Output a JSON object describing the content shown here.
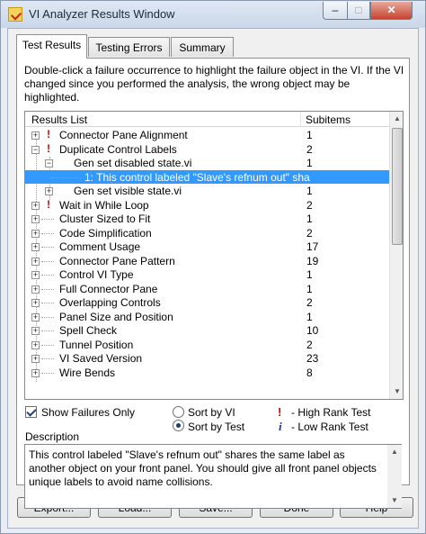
{
  "window": {
    "title": "VI Analyzer Results Window",
    "minimize_glyph": "–",
    "maximize_glyph": "□",
    "close_glyph": "✕"
  },
  "tabs": [
    {
      "label": "Test Results",
      "active": true
    },
    {
      "label": "Testing Errors",
      "active": false
    },
    {
      "label": "Summary",
      "active": false
    }
  ],
  "instructions": "Double-click a failure occurrence to highlight the failure object in the VI.  If the VI changed since you performed the analysis, the wrong object may be highlighted.",
  "results": {
    "header": {
      "results_list": "Results List",
      "subitems": "Subitems"
    },
    "rows": [
      {
        "label": "Connector Pane Alignment",
        "subitems": "1",
        "expander": "+",
        "rank": "!"
      },
      {
        "label": "Duplicate Control Labels",
        "subitems": "2",
        "expander": "−",
        "rank": "!"
      },
      {
        "label": "Gen set disabled state.vi",
        "subitems": "1",
        "expander": "−",
        "rank": ""
      },
      {
        "label": "1: This control labeled \"Slave's refnum out\" sha",
        "subitems": "",
        "expander": "",
        "rank": "",
        "selected": true
      },
      {
        "label": "Gen set visible state.vi",
        "subitems": "1",
        "expander": "+",
        "rank": ""
      },
      {
        "label": "Wait in While Loop",
        "subitems": "2",
        "expander": "+",
        "rank": "!"
      },
      {
        "label": "Cluster Sized to Fit",
        "subitems": "1",
        "expander": "+",
        "rank": ""
      },
      {
        "label": "Code Simplification",
        "subitems": "2",
        "expander": "+",
        "rank": ""
      },
      {
        "label": "Comment Usage",
        "subitems": "17",
        "expander": "+",
        "rank": ""
      },
      {
        "label": "Connector Pane Pattern",
        "subitems": "19",
        "expander": "+",
        "rank": ""
      },
      {
        "label": "Control VI Type",
        "subitems": "1",
        "expander": "+",
        "rank": ""
      },
      {
        "label": "Full Connector Pane",
        "subitems": "1",
        "expander": "+",
        "rank": ""
      },
      {
        "label": "Overlapping Controls",
        "subitems": "2",
        "expander": "+",
        "rank": ""
      },
      {
        "label": "Panel Size and Position",
        "subitems": "1",
        "expander": "+",
        "rank": ""
      },
      {
        "label": "Spell Check",
        "subitems": "10",
        "expander": "+",
        "rank": ""
      },
      {
        "label": "Tunnel Position",
        "subitems": "2",
        "expander": "+",
        "rank": ""
      },
      {
        "label": "VI Saved Version",
        "subitems": "23",
        "expander": "+",
        "rank": ""
      },
      {
        "label": "Wire Bends",
        "subitems": "8",
        "expander": "+",
        "rank": ""
      }
    ],
    "scroll_up": "▲",
    "scroll_down": "▼"
  },
  "options": {
    "show_failures_only": {
      "label": "Show Failures Only",
      "checked": true
    },
    "sort_by_vi": {
      "label": "Sort by VI",
      "selected": false
    },
    "sort_by_test": {
      "label": "Sort by Test",
      "selected": true
    }
  },
  "legend": {
    "high": {
      "glyph": "!",
      "label": "- High Rank Test",
      "color": "#d40000"
    },
    "low": {
      "glyph": "i",
      "label": "- Low Rank Test",
      "color": "#1a2fb0"
    }
  },
  "description": {
    "label": "Description",
    "text": "This control labeled \"Slave's refnum out\" shares the same label as another object on your front panel.  You should give all front panel objects unique labels to avoid name collisions.",
    "scroll_up": "▲",
    "scroll_down": "▼"
  },
  "buttons": {
    "export": "Export...",
    "load": "Load...",
    "save": "Save...",
    "done": "Done",
    "help": "Help"
  },
  "colors": {
    "selection": "#3399ff",
    "high_rank": "#d40000",
    "low_rank": "#1a2fb0"
  }
}
